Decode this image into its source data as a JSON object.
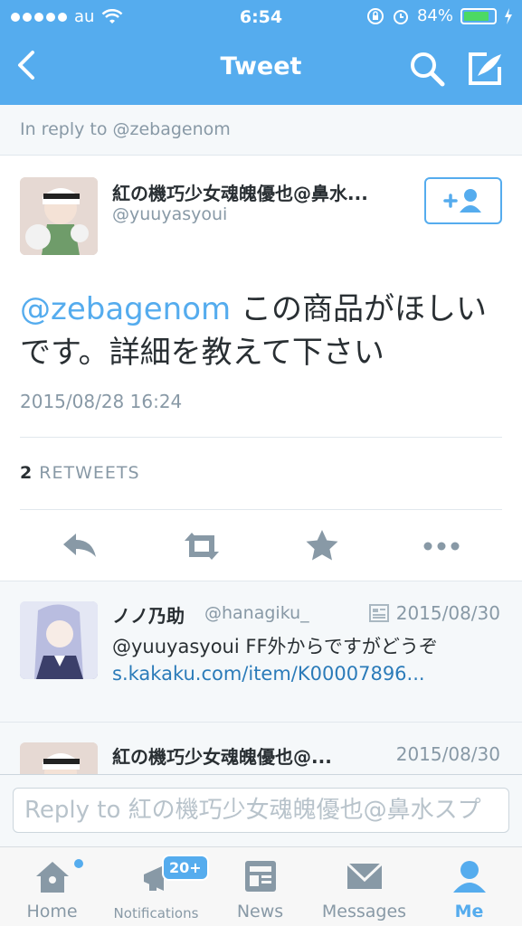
{
  "status_bar": {
    "carrier": "au",
    "time": "6:54",
    "battery": "84%",
    "battery_level": 0.84
  },
  "nav": {
    "title": "Tweet",
    "icons": [
      "back-icon",
      "search-icon",
      "compose-icon"
    ]
  },
  "reply_banner": "In reply to @zebagenom",
  "tweet": {
    "name": "紅の機巧少女魂魄優也@鼻水...",
    "handle": "@yuuyasyoui",
    "mention": "@zebagenom",
    "text": " この商品がほしいです。詳細を教えて下さい",
    "timestamp": "2015/08/28 16:24",
    "retweet_count": "2",
    "retweet_label": "RETWEETS"
  },
  "replies": [
    {
      "name": "ノノ乃助",
      "handle": "@hanagiku_",
      "date": "2015/08/30",
      "text": "@yuuyasyoui FF外からですがどうぞ",
      "link": "s.kakaku.com/item/K00007896..."
    },
    {
      "name": "紅の機巧少女魂魄優也@...",
      "date": "2015/08/30"
    }
  ],
  "reply_input": {
    "placeholder": "Reply to 紅の機巧少女魂魄優也@鼻水スプ"
  },
  "tabs": [
    {
      "label": "Home",
      "icon": "home-icon"
    },
    {
      "label": "Notifications",
      "icon": "notifications-icon",
      "badge": "20+"
    },
    {
      "label": "News",
      "icon": "news-icon"
    },
    {
      "label": "Messages",
      "icon": "messages-icon"
    },
    {
      "label": "Me",
      "icon": "me-icon"
    }
  ],
  "colors": {
    "accent": "#55acee",
    "text": "#292f33",
    "muted": "#8899a6"
  }
}
